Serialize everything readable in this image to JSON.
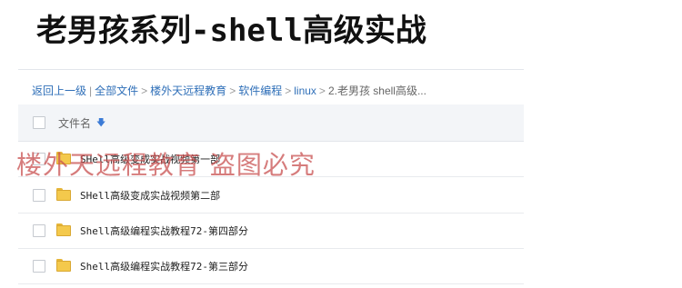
{
  "title": "老男孩系列-shell高级实战",
  "breadcrumb": {
    "items": [
      "返回上一级",
      "全部文件",
      "楼外天远程教育",
      "软件编程",
      "linux"
    ],
    "separators": [
      "|",
      ">",
      ">",
      ">",
      ">"
    ],
    "current": "2.老男孩 shell高级..."
  },
  "list": {
    "header_label": "文件名",
    "sort_icon": "sort-down-icon",
    "rows": [
      {
        "name": "SHell高级变成实战视频第一部",
        "icon": "folder-icon"
      },
      {
        "name": "SHell高级变成实战视频第二部",
        "icon": "folder-icon"
      },
      {
        "name": "Shell高级编程实战教程72-第四部分",
        "icon": "folder-icon"
      },
      {
        "name": "Shell高级编程实战教程72-第三部分",
        "icon": "folder-icon"
      }
    ]
  },
  "watermark": "楼外天远程教育 盗图必究",
  "colors": {
    "link": "#2f6fb8",
    "folder": "#f4c94c",
    "header_bg": "#f3f5f8",
    "watermark": "#c85050"
  }
}
